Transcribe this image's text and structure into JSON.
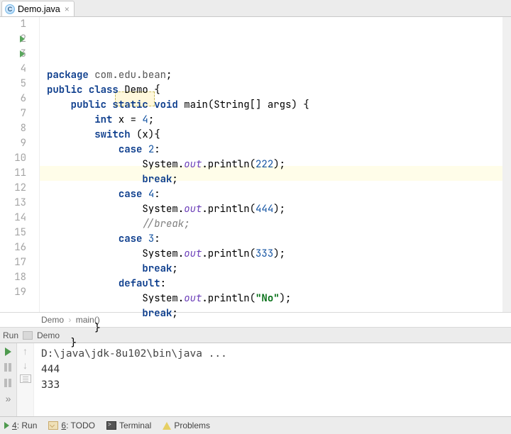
{
  "tab": {
    "icon_letter": "C",
    "label": "Demo.java"
  },
  "gutter": {
    "lines": [
      "1",
      "2",
      "3",
      "4",
      "5",
      "6",
      "7",
      "8",
      "9",
      "10",
      "11",
      "12",
      "13",
      "14",
      "15",
      "16",
      "17",
      "18",
      "19"
    ]
  },
  "code": {
    "package_kw": "package",
    "package_name": "com.edu.bean",
    "public_kw": "public",
    "class_kw": "class",
    "class_name": "Demo",
    "static_kw": "static",
    "void_kw": "void",
    "main_name": "main",
    "string_arr": "String[] args",
    "int_kw": "int",
    "var": "x",
    "eq": " = ",
    "val4": "4",
    "switch_kw": "switch",
    "case_kw": "case",
    "c2": "2",
    "c4": "4",
    "c3": "3",
    "default_kw": "default",
    "sys": "System",
    "out": "out",
    "println": "println",
    "lit222": "222",
    "lit444": "444",
    "lit333": "333",
    "lit_no": "\"No\"",
    "break_kw": "break",
    "break_cmt": "//break;"
  },
  "breadcrumb": {
    "a": "Demo",
    "b": "main()"
  },
  "run_header": {
    "title": "Run",
    "config": "Demo"
  },
  "console": {
    "cmd": "D:\\java\\jdk-8u102\\bin\\java ...",
    "out1": "444",
    "out2": "333"
  },
  "bottom": {
    "run": "4: Run",
    "todo": "6: TODO",
    "terminal": "Terminal",
    "problems": "Problems"
  }
}
